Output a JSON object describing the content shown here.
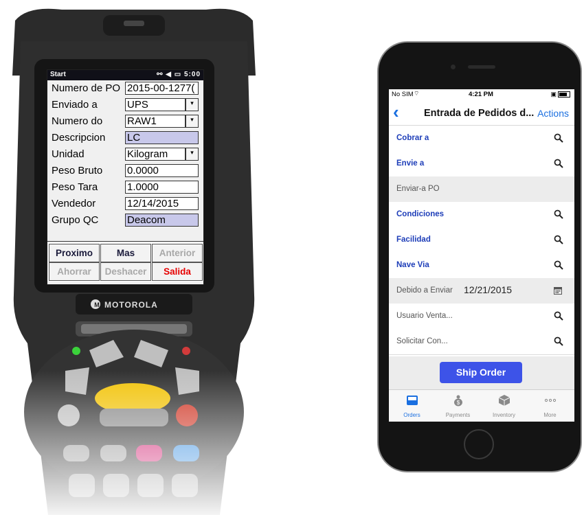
{
  "handheld": {
    "brand": "MOTOROLA",
    "status_bar": {
      "start": "Start",
      "time": "5:00"
    },
    "fields": [
      {
        "label": "Numero de PO",
        "value": "2015-00-1277(",
        "kind": "text"
      },
      {
        "label": "Enviado a",
        "value": "UPS",
        "kind": "dropdown"
      },
      {
        "label": "Numero do",
        "value": "RAW1",
        "kind": "dropdown"
      },
      {
        "label": "Descripcion",
        "value": "LC",
        "kind": "readonly"
      },
      {
        "label": "Unidad",
        "value": "Kilogram",
        "kind": "dropdown"
      },
      {
        "label": "Peso Bruto",
        "value": "0.0000",
        "kind": "text"
      },
      {
        "label": "Peso Tara",
        "value": "1.0000",
        "kind": "text"
      },
      {
        "label": "Vendedor",
        "value": "12/14/2015",
        "kind": "text"
      },
      {
        "label": "Grupo QC",
        "value": "Deacom",
        "kind": "readonly"
      }
    ],
    "buttons": {
      "proximo": "Proximo",
      "mas": "Mas",
      "anterior": "Anterior",
      "ahorrar": "Ahorrar",
      "deshacer": "Deshacer",
      "salida": "Salida"
    },
    "colors": {
      "readonly_field": "#c8c8ea",
      "exit_red": "#e60000"
    }
  },
  "iphone": {
    "status_bar": {
      "carrier": "No SIM",
      "time": "4:21 PM"
    },
    "nav": {
      "title": "Entrada de Pedidos d...",
      "actions": "Actions"
    },
    "rows": [
      {
        "label": "Cobrar a",
        "value": "",
        "icon": "search-icon",
        "style": "link"
      },
      {
        "label": "Envie a",
        "value": "",
        "icon": "search-icon",
        "style": "link"
      },
      {
        "label": "Enviar-a PO",
        "value": "",
        "icon": "",
        "style": "gray"
      },
      {
        "label": "Condiciones",
        "value": "",
        "icon": "search-icon",
        "style": "link"
      },
      {
        "label": "Facilidad",
        "value": "",
        "icon": "search-icon",
        "style": "link"
      },
      {
        "label": "Nave Via",
        "value": "",
        "icon": "search-icon",
        "style": "link"
      },
      {
        "label": "Debido a Enviar",
        "value": "12/21/2015",
        "icon": "calendar-icon",
        "style": "gray"
      },
      {
        "label": "Usuario Venta...",
        "value": "",
        "icon": "search-icon",
        "style": "muted"
      },
      {
        "label": "Solicitar Con...",
        "value": "",
        "icon": "search-icon",
        "style": "muted"
      }
    ],
    "ship_button": "Ship Order",
    "tabs": [
      {
        "label": "Orders",
        "icon": "orders-icon",
        "active": true
      },
      {
        "label": "Payments",
        "icon": "payments-icon",
        "active": false
      },
      {
        "label": "Inventory",
        "icon": "inventory-icon",
        "active": false
      },
      {
        "label": "More",
        "icon": "more-icon",
        "active": false
      }
    ],
    "colors": {
      "accent": "#1a6fe0",
      "label_blue": "#1d3db8",
      "ship_button": "#3d53e8"
    }
  }
}
